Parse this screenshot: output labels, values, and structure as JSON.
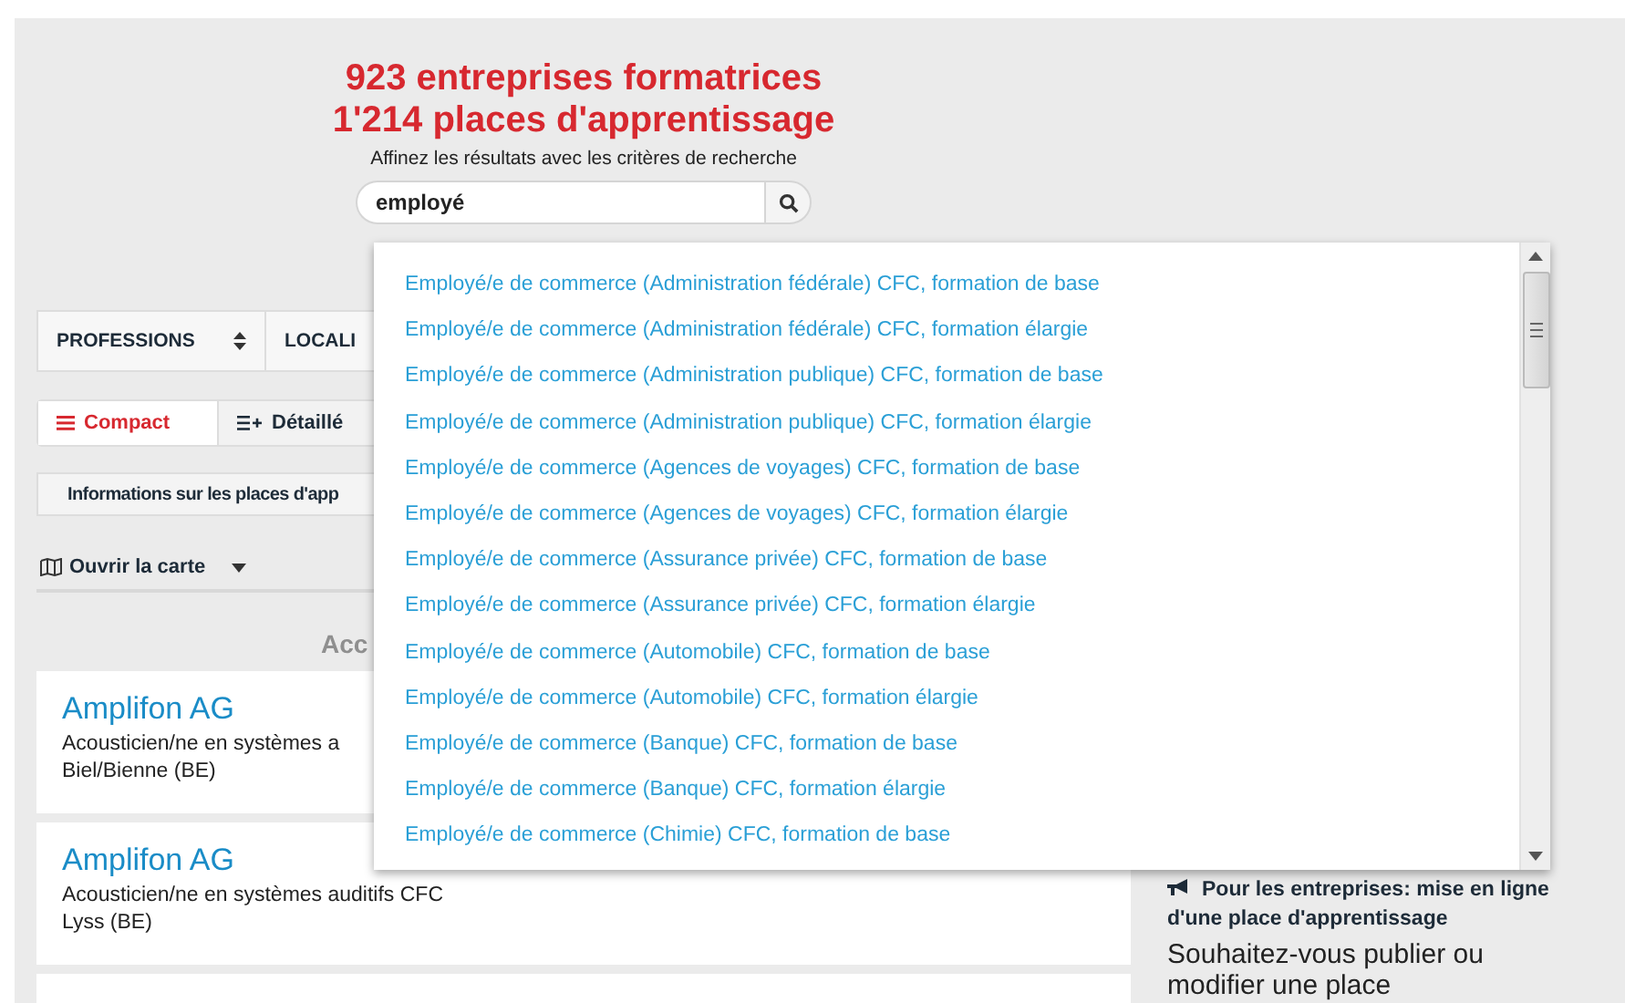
{
  "header": {
    "title_lines": [
      "923 entreprises formatrices",
      "1'214 places d'apprentissage"
    ],
    "subtitle": "Affinez les résultats avec les critères de recherche"
  },
  "search": {
    "value": "employé"
  },
  "filters": [
    {
      "label": "PROFESSIONS"
    },
    {
      "label": "LOCALI"
    }
  ],
  "view_options": [
    {
      "label": "Compact",
      "kind": "list",
      "selected": true
    },
    {
      "label": "Détaillé",
      "kind": "detail",
      "selected": false
    }
  ],
  "info_bar": "Informations sur les places d'app",
  "map_button": "Ouvrir la carte",
  "section_heading": "Acc",
  "results": [
    {
      "company": "Amplifon AG",
      "profession": "Acousticien/ne en systèmes a",
      "location": "Biel/Bienne (BE)"
    },
    {
      "company": "Amplifon AG",
      "profession": "Acousticien/ne en systèmes auditifs CFC",
      "location": "Lyss (BE)"
    }
  ],
  "sidebar": {
    "link": "Pour les entreprises: mise en ligne d'une place d'apprentissage",
    "heading": "Souhaitez-vous publier ou modifier une place"
  },
  "suggestions": [
    "Employé/e de commerce (Administration fédérale) CFC, formation de base",
    "Employé/e de commerce (Administration fédérale) CFC, formation élargie",
    "Employé/e de commerce (Administration publique) CFC, formation de base",
    "Employé/e de commerce (Administration publique) CFC, formation élargie",
    "Employé/e de commerce (Agences de voyages) CFC, formation de base",
    "Employé/e de commerce (Agences de voyages) CFC, formation élargie",
    "Employé/e de commerce (Assurance privée) CFC, formation de base",
    "Employé/e de commerce (Assurance privée) CFC, formation élargie",
    "Employé/e de commerce (Automobile) CFC, formation de base",
    "Employé/e de commerce (Automobile) CFC, formation élargie",
    "Employé/e de commerce (Banque) CFC, formation de base",
    "Employé/e de commerce (Banque) CFC, formation élargie",
    "Employé/e de commerce (Chimie) CFC, formation de base"
  ]
}
